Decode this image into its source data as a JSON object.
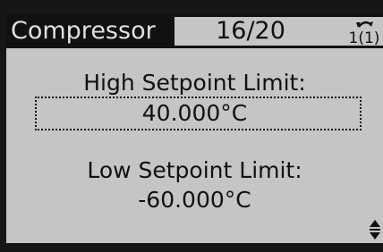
{
  "header": {
    "menu_title": "Compressor",
    "param_index": "16/20",
    "setup_icon": "setup-1-icon"
  },
  "params": [
    {
      "label": "High Setpoint Limit:",
      "value": "40.000°C",
      "focused": true
    },
    {
      "label": "Low Setpoint Limit:",
      "value": "-60.000°C",
      "focused": false
    }
  ],
  "scroll_icon": "up-down-arrow-icon",
  "colors": {
    "screen_bg": "#c5c5c5",
    "ink": "#111111",
    "header_text": "#e0e0e0"
  }
}
